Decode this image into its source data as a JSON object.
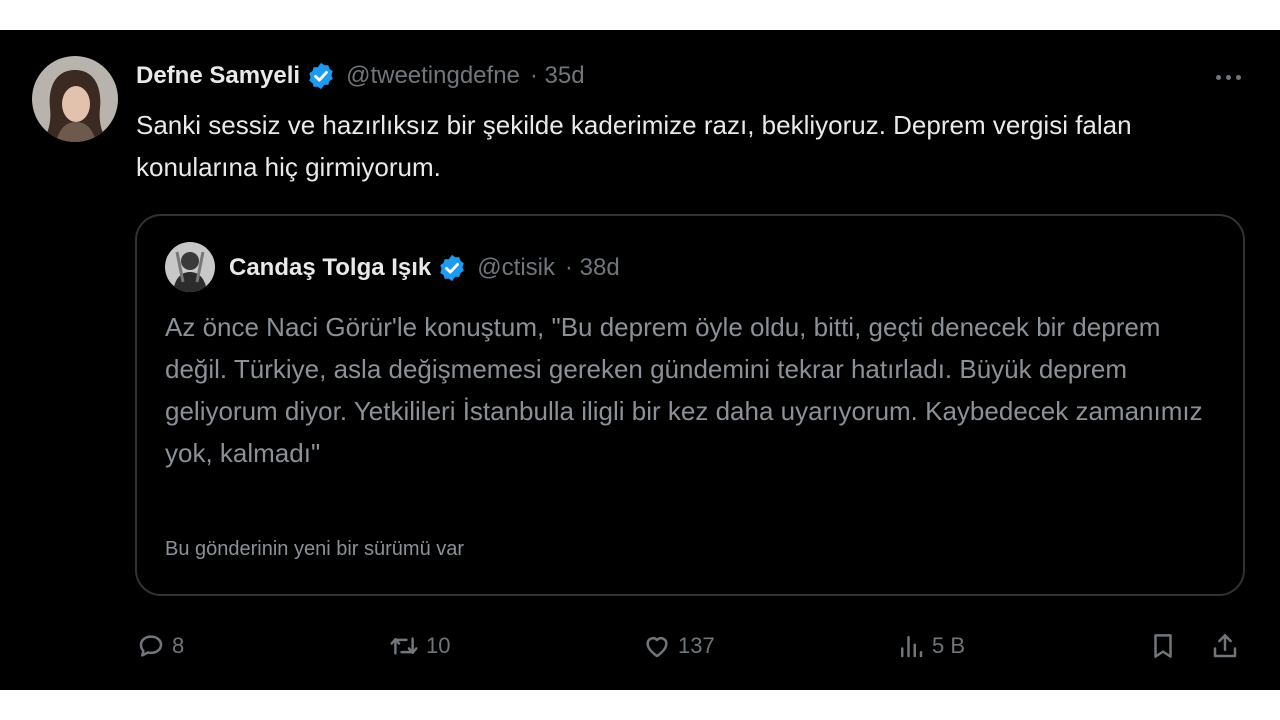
{
  "tweet": {
    "author_name": "Defne Samyeli",
    "handle": "@tweetingdefne",
    "age": "· 35d",
    "text": "Sanki sessiz ve hazırlıksız bir şekilde kaderimize razı, bekliyoruz. Deprem vergisi falan konularına hiç girmiyorum.",
    "more_icon": "more-horizontal-icon"
  },
  "quote": {
    "author_name": "Candaş Tolga Işık",
    "handle": "@ctisik",
    "age": "· 38d",
    "text": "Az önce Naci Görür'le konuştum, \"Bu deprem öyle oldu, bitti, geçti denecek bir deprem değil. Türkiye, asla değişmemesi gereken gündemini tekrar hatırladı. Büyük deprem geliyorum diyor. Yetkilileri İstanbulla iligli bir kez daha uyarıyorum. Kaybedecek zamanımız yok, kalmadı\"",
    "note": "Bu gönderinin yeni bir sürümü var"
  },
  "actions": {
    "replies": "8",
    "reposts": "10",
    "likes": "137",
    "views": "5 B",
    "icons": [
      "reply-icon",
      "repost-icon",
      "like-icon",
      "views-icon",
      "bookmark-icon",
      "share-icon"
    ]
  },
  "colors": {
    "background": "#000000",
    "text": "#e7e9ea",
    "muted": "#71767b",
    "verified": "#1d9bf0",
    "border": "#2f3336"
  }
}
